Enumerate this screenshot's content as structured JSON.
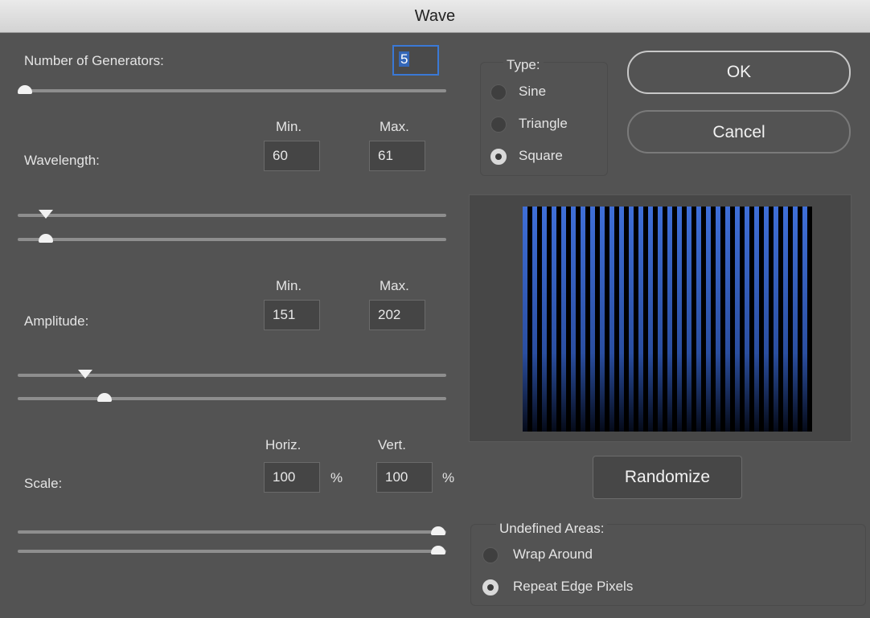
{
  "window": {
    "title": "Wave"
  },
  "generators": {
    "label": "Number of Generators:",
    "value": "5",
    "slider_fraction": 0.0
  },
  "wavelength": {
    "label": "Wavelength:",
    "min_label": "Min.",
    "max_label": "Max.",
    "min": "60",
    "max": "61",
    "min_slider": 0.06,
    "max_slider": 0.06
  },
  "amplitude": {
    "label": "Amplitude:",
    "min_label": "Min.",
    "max_label": "Max.",
    "min": "151",
    "max": "202",
    "min_slider": 0.16,
    "max_slider": 0.21
  },
  "scale": {
    "label": "Scale:",
    "horiz_label": "Horiz.",
    "vert_label": "Vert.",
    "horiz": "100",
    "vert": "100",
    "unit": "%",
    "horiz_slider": 1.0,
    "vert_slider": 1.0
  },
  "type": {
    "title": "Type:",
    "options": [
      {
        "label": "Sine",
        "selected": false
      },
      {
        "label": "Triangle",
        "selected": false
      },
      {
        "label": "Square",
        "selected": true
      }
    ]
  },
  "buttons": {
    "ok": "OK",
    "cancel": "Cancel",
    "randomize": "Randomize"
  },
  "undefined_areas": {
    "title": "Undefined Areas:",
    "options": [
      {
        "label": "Wrap Around",
        "selected": false
      },
      {
        "label": "Repeat Edge Pixels",
        "selected": true
      }
    ]
  },
  "preview": {
    "stripe_color": "#3f6fd8",
    "bar_count": 30
  }
}
